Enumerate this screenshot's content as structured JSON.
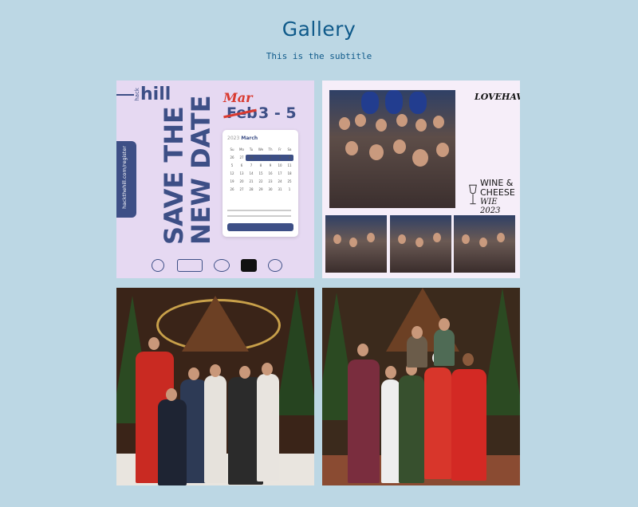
{
  "header": {
    "title": "Gallery",
    "subtitle": "This is the subtitle"
  },
  "gallery": {
    "tiles": [
      {
        "kind": "save-the-date-poster",
        "logo": {
          "small": "hack",
          "big": "hill"
        },
        "side_tab": "hackthehill.com/register",
        "headline_line1": "SAVE THE",
        "headline_line2": "NEW DATE",
        "new_month": "Mar",
        "old_month": "Feb",
        "dates": "3 - 5",
        "calendar": {
          "year": "2023",
          "month": "March",
          "weekdays": [
            "Su",
            "Mo",
            "Tu",
            "We",
            "Th",
            "Fr",
            "Sa"
          ],
          "days": [
            "26",
            "27",
            "28",
            "1",
            "2",
            "3",
            "4",
            "5",
            "6",
            "7",
            "8",
            "9",
            "10",
            "11",
            "12",
            "13",
            "14",
            "15",
            "16",
            "17",
            "18",
            "19",
            "20",
            "21",
            "22",
            "23",
            "24",
            "25",
            "26",
            "27",
            "28",
            "29",
            "30",
            "31",
            "1"
          ]
        }
      },
      {
        "kind": "event-photo-collage",
        "brand": "LOVEHAVEN!",
        "title_line1": "WINE &",
        "title_line2": "CHEESE",
        "subtitle": "WIE 2023"
      },
      {
        "kind": "group-photo"
      },
      {
        "kind": "group-photo"
      }
    ]
  },
  "colors": {
    "background": "#bcd7e4",
    "heading": "#0f5a8a",
    "poster_accent": "#3d4f86",
    "poster_red": "#d93a2f"
  }
}
